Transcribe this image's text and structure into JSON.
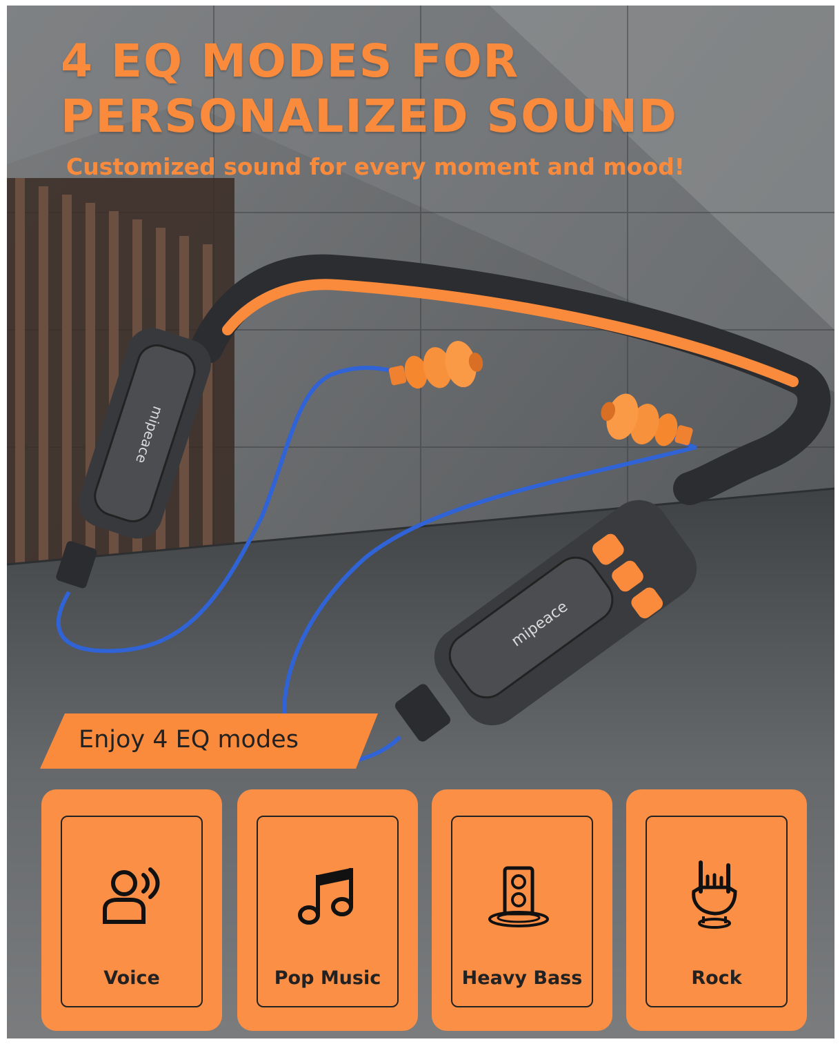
{
  "header": {
    "line1": "4 EQ MODES FOR",
    "line2": "PERSONALIZED SOUND",
    "subtitle": "Customized sound for every moment and mood!"
  },
  "product": {
    "brand": "mipeace"
  },
  "banner": {
    "text": "Enjoy 4 EQ modes"
  },
  "modes": [
    {
      "label": "Voice",
      "icon": "voice-icon"
    },
    {
      "label": "Pop Music",
      "icon": "music-note-icon"
    },
    {
      "label": "Heavy Bass",
      "icon": "speaker-icon"
    },
    {
      "label": "Rock",
      "icon": "rock-hand-icon"
    }
  ],
  "colors": {
    "accent": "#fb8b3c",
    "card": "#fb8f46",
    "cable_blue": "#2f63d6",
    "body_dark": "#3a3b3e"
  }
}
